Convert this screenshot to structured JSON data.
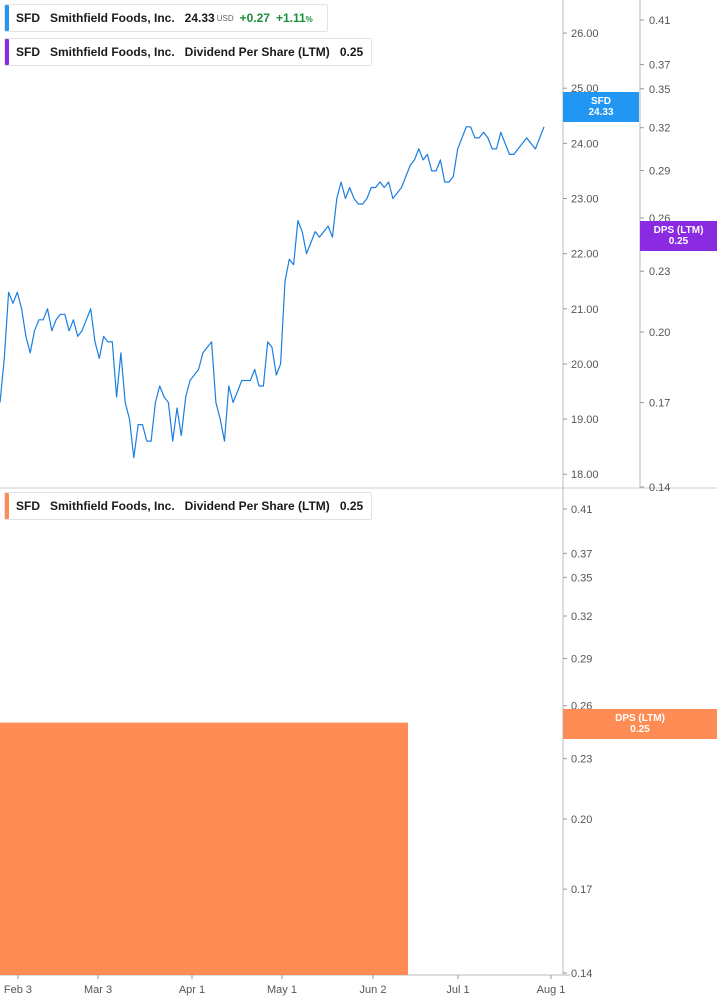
{
  "colors": {
    "price_line": "#1a7fe0",
    "price_tag": "#2196f3",
    "dps_top": "#8a2be2",
    "dps_bottom": "#ff8c55",
    "positive": "#1b8f3a",
    "axis": "#999999"
  },
  "legend_price": {
    "symbol": "SFD",
    "name": "Smithfield Foods, Inc.",
    "price": "24.33",
    "currency": "USD",
    "change": "+0.27",
    "change_pct": "+1.11",
    "pct_sign": "%"
  },
  "legend_dps_top": {
    "symbol": "SFD",
    "name": "Smithfield Foods, Inc.",
    "metric": "Dividend Per Share (LTM)",
    "value": "0.25"
  },
  "legend_dps_bottom": {
    "symbol": "SFD",
    "name": "Smithfield Foods, Inc.",
    "metric": "Dividend Per Share (LTM)",
    "value": "0.25"
  },
  "tags": {
    "price_label": "SFD",
    "price_value": "24.33",
    "dps_top_label": "DPS (LTM)",
    "dps_top_value": "0.25",
    "dps_bottom_label": "DPS (LTM)",
    "dps_bottom_value": "0.25"
  },
  "chart_data": [
    {
      "type": "line",
      "series": [
        {
          "name": "SFD",
          "values": [
            19.3,
            20.1,
            21.3,
            21.1,
            21.3,
            21.0,
            20.5,
            20.2,
            20.6,
            20.8,
            20.8,
            21.0,
            20.6,
            20.8,
            20.9,
            20.9,
            20.6,
            20.8,
            20.5,
            20.6,
            20.8,
            21.0,
            20.4,
            20.1,
            20.5,
            20.4,
            20.4,
            19.4,
            20.2,
            19.3,
            19.0,
            18.3,
            18.9,
            18.9,
            18.6,
            18.6,
            19.3,
            19.6,
            19.4,
            19.3,
            18.6,
            19.2,
            18.7,
            19.4,
            19.7,
            19.8,
            19.9,
            20.2,
            20.3,
            20.4,
            19.3,
            19.0,
            18.6,
            19.6,
            19.3,
            19.5,
            19.7,
            19.7,
            19.7,
            19.9,
            19.6,
            19.6,
            20.4,
            20.3,
            19.8,
            20.0,
            21.5,
            21.9,
            21.8,
            22.6,
            22.4,
            22.0,
            22.2,
            22.4,
            22.3,
            22.4,
            22.5,
            22.3,
            23.0,
            23.3,
            23.0,
            23.2,
            23.0,
            22.9,
            22.9,
            23.0,
            23.2,
            23.2,
            23.3,
            23.2,
            23.3,
            23.0,
            23.1,
            23.2,
            23.4,
            23.6,
            23.7,
            23.9,
            23.7,
            23.8,
            23.5,
            23.5,
            23.7,
            23.3,
            23.3,
            23.4,
            23.9,
            24.1,
            24.3,
            24.3,
            24.1,
            24.1,
            24.2,
            24.1,
            23.9,
            23.9,
            24.2,
            24.0,
            23.8,
            23.8,
            23.9,
            24.0,
            24.1,
            24.0,
            23.9,
            24.1,
            24.3
          ]
        }
      ],
      "ylim": [
        17.75,
        26.6
      ],
      "yticks": [
        "18.00",
        "19.00",
        "20.00",
        "21.00",
        "22.00",
        "23.00",
        "24.00",
        "25.00",
        "26.00"
      ]
    },
    {
      "type": "area",
      "series": [
        {
          "name": "Dividend Per Share (LTM)",
          "values": [
            0.25,
            0.25
          ],
          "x": [
            "Feb 3",
            "Jun 10"
          ]
        }
      ],
      "yticks": [
        "0.14",
        "0.17",
        "0.20",
        "0.23",
        "0.26",
        "0.29",
        "0.32",
        "0.35",
        "0.37",
        "0.41"
      ],
      "scale": "log"
    }
  ],
  "x_axis": {
    "ticks": [
      "Feb 3",
      "Mar 3",
      "Apr 1",
      "May 1",
      "Jun 2",
      "Jul 1",
      "Aug 1"
    ]
  },
  "dps_top_axis": {
    "ticks": [
      "0.14",
      "0.17",
      "0.20",
      "0.23",
      "0.26",
      "0.29",
      "0.32",
      "0.35",
      "0.37",
      "0.41"
    ]
  }
}
